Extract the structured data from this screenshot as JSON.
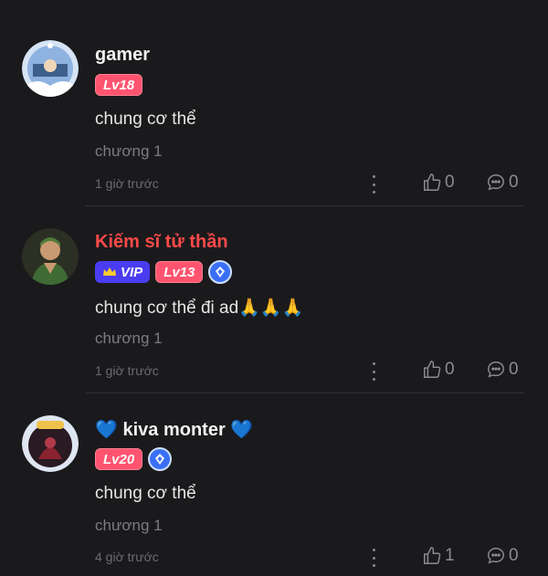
{
  "comments": [
    {
      "username": "gamer",
      "level": "Lv18",
      "text": "chung cơ thể",
      "chapter": "chương 1",
      "time": "1 giờ trước",
      "likes": "0",
      "replies": "0"
    },
    {
      "username": "Kiếm sĩ tử thần",
      "vip": "VIP",
      "level": "Lv13",
      "text": "chung cơ thể đi ad",
      "emoji": "🙏🙏🙏",
      "chapter": "chương 1",
      "time": "1 giờ trước",
      "likes": "0",
      "replies": "0"
    },
    {
      "username_prefix": "💙",
      "username": "kiva monter",
      "username_suffix": "💙",
      "level": "Lv20",
      "text": "chung cơ thể",
      "chapter": "chương 1",
      "time": "4 giờ trước",
      "likes": "1",
      "replies": "0"
    }
  ],
  "colors": {
    "background": "#1a1a1c",
    "level_badge": "#ff5470",
    "vip_badge": "#4a3cf0",
    "red_name": "#ff4a4a"
  },
  "icons": [
    "avatar",
    "crown-icon",
    "gem-icon",
    "more-icon",
    "thumbs-up-icon",
    "comment-icon"
  ]
}
